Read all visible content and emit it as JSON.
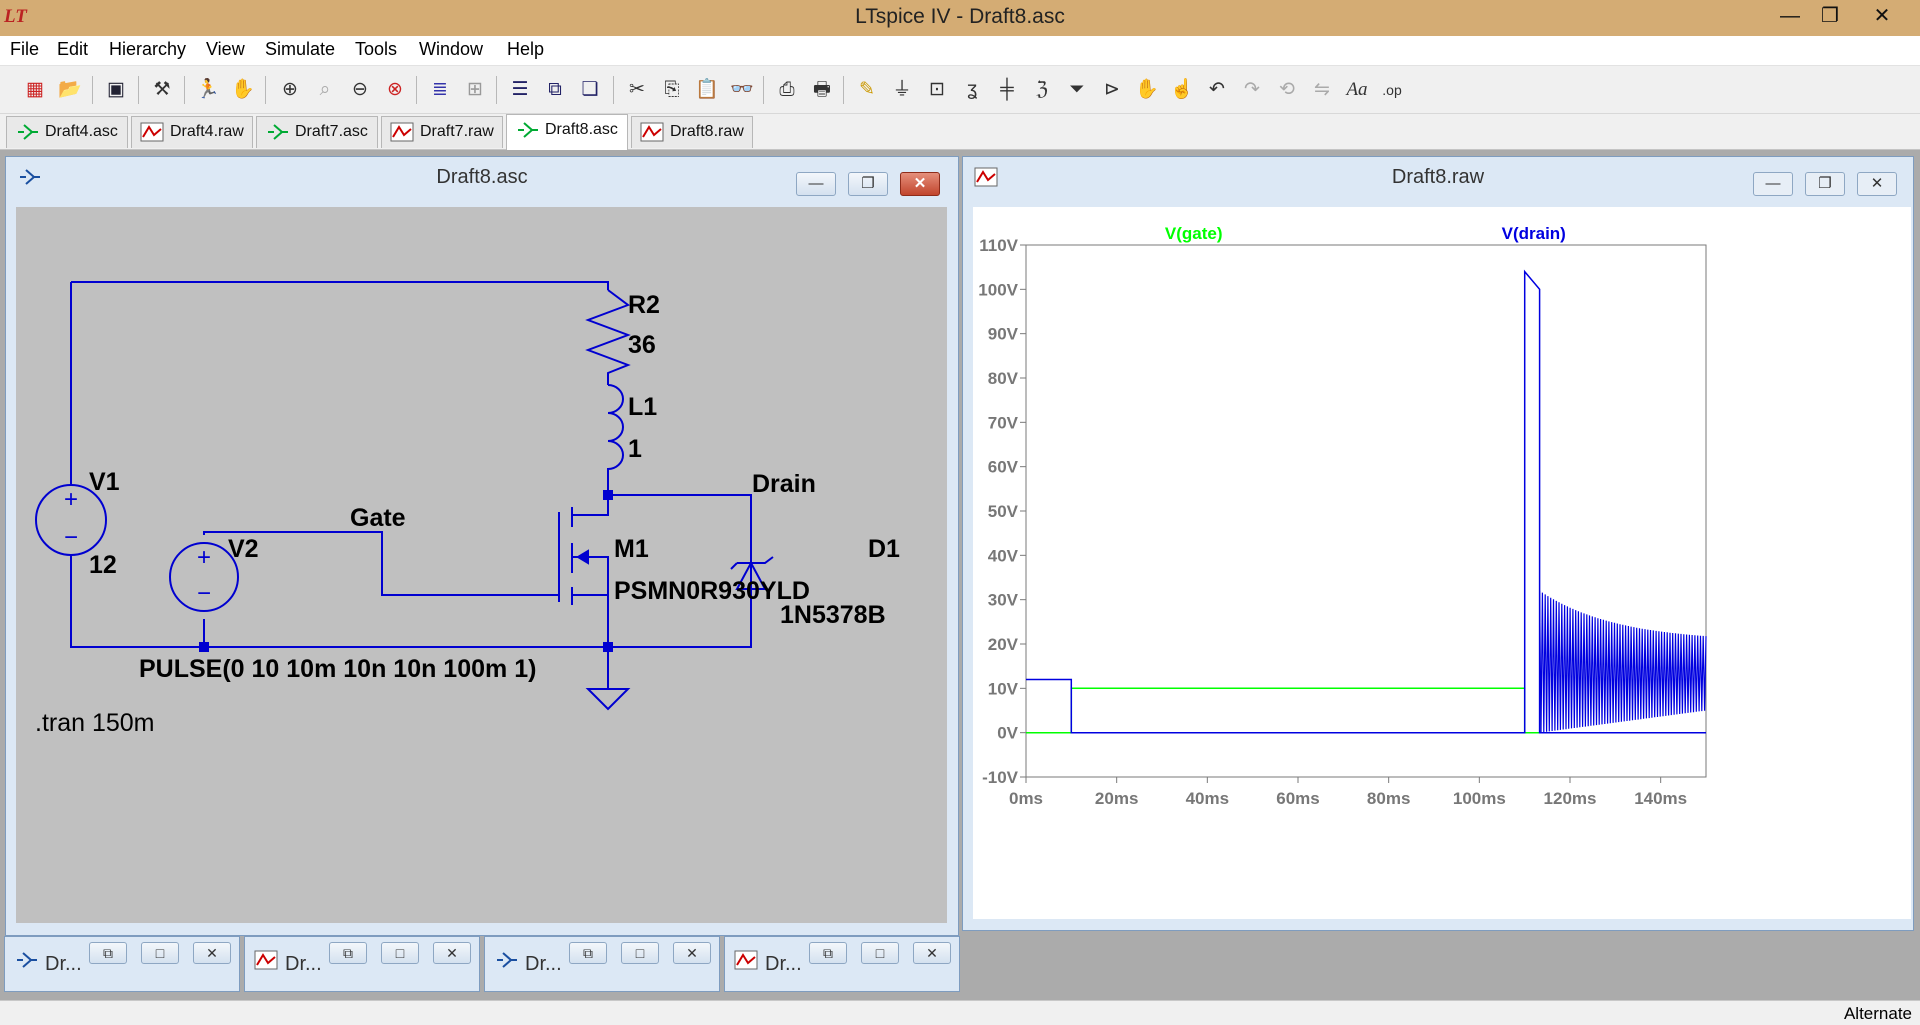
{
  "app": {
    "title": "LTspice IV - Draft8.asc",
    "logo_text": "LT",
    "window_controls": {
      "minimize": "—",
      "maximize": "❐",
      "close": "✕"
    }
  },
  "menu": [
    "File",
    "Edit",
    "Hierarchy",
    "View",
    "Simulate",
    "Tools",
    "Window",
    "Help"
  ],
  "toolbar_icons": [
    "new-schematic-icon",
    "open-icon",
    "save-icon",
    "control-panel-icon",
    "run-icon",
    "halt-icon",
    "zoom-in-icon",
    "zoom-rect-icon",
    "zoom-out-icon",
    "zoom-cancel-icon",
    "autorange-icon",
    "grid-icon",
    "tile-horizontal-icon",
    "tile-vertical-icon",
    "cascade-icon",
    "cut-icon",
    "copy-icon",
    "paste-icon",
    "find-icon",
    "print-preview-icon",
    "print-icon",
    "draw-wire-icon",
    "ground-icon",
    "label-net-icon",
    "resistor-icon",
    "capacitor-icon",
    "inductor-icon",
    "diode-icon",
    "component-icon",
    "move-icon",
    "drag-icon",
    "undo-icon",
    "redo-icon",
    "rotate-icon",
    "mirror-icon",
    "text-icon",
    "spice-directive-icon"
  ],
  "tabs": [
    {
      "label": "Draft4.asc",
      "kind": "schematic"
    },
    {
      "label": "Draft4.raw",
      "kind": "waveform"
    },
    {
      "label": "Draft7.asc",
      "kind": "schematic"
    },
    {
      "label": "Draft7.raw",
      "kind": "waveform"
    },
    {
      "label": "Draft8.asc",
      "kind": "schematic",
      "active": true
    },
    {
      "label": "Draft8.raw",
      "kind": "waveform"
    }
  ],
  "schematic_window": {
    "title": "Draft8.asc",
    "wire_color": "#0000d0",
    "labels": {
      "r2_name": "R2",
      "r2_value": "36",
      "l1_name": "L1",
      "l1_value": "1",
      "v1_name": "V1",
      "v1_value": "12",
      "v2_name": "V2",
      "m1_name": "M1",
      "m1_value": "PSMN0R930YLD",
      "d1_name": "D1",
      "d1_value": "1N5378B",
      "net_drain": "Drain",
      "net_gate": "Gate",
      "pulse": "PULSE(0 10 10m 10n 10n 100m 1)",
      "directive": ".tran 150m",
      "plus": "+",
      "minus": "−"
    }
  },
  "waveform_window": {
    "title": "Draft8.raw",
    "controls": {
      "minimize": "—",
      "maximize": "❐",
      "close": "✕"
    }
  },
  "chart_data": {
    "type": "line",
    "xlabel": "",
    "ylabel": "",
    "xlim": [
      0,
      150
    ],
    "ylim": [
      -10,
      110
    ],
    "x_unit": "ms",
    "y_unit": "V",
    "x_ticks": [
      "0ms",
      "20ms",
      "40ms",
      "60ms",
      "80ms",
      "100ms",
      "120ms",
      "140ms"
    ],
    "y_ticks": [
      "-10V",
      "0V",
      "10V",
      "20V",
      "30V",
      "40V",
      "50V",
      "60V",
      "70V",
      "80V",
      "90V",
      "100V",
      "110V"
    ],
    "series": [
      {
        "name": "V(gate)",
        "color": "#00ff00",
        "x": [
          0,
          10,
          10,
          110,
          110,
          150
        ],
        "y": [
          0,
          0,
          10,
          10,
          0,
          0
        ]
      },
      {
        "name": "V(drain)",
        "color": "#0000e0",
        "x": [
          0,
          10,
          10,
          110,
          110,
          113.3,
          113.3,
          150
        ],
        "y": [
          12,
          12,
          0,
          0,
          104,
          100,
          0,
          0
        ],
        "oscillation": {
          "x_start": 113.3,
          "x_end": 150,
          "upper_start": 32,
          "upper_end": 20.5,
          "lower_start": 0,
          "lower_end": 5
        }
      }
    ]
  },
  "minimized_windows": [
    {
      "title": "Dr...",
      "kind": "schematic"
    },
    {
      "title": "Dr...",
      "kind": "waveform"
    },
    {
      "title": "Dr...",
      "kind": "schematic"
    },
    {
      "title": "Dr...",
      "kind": "waveform"
    }
  ],
  "mini_controls": {
    "restore": "⧉",
    "maximize": "□",
    "close": "✕"
  },
  "status": "Alternate"
}
